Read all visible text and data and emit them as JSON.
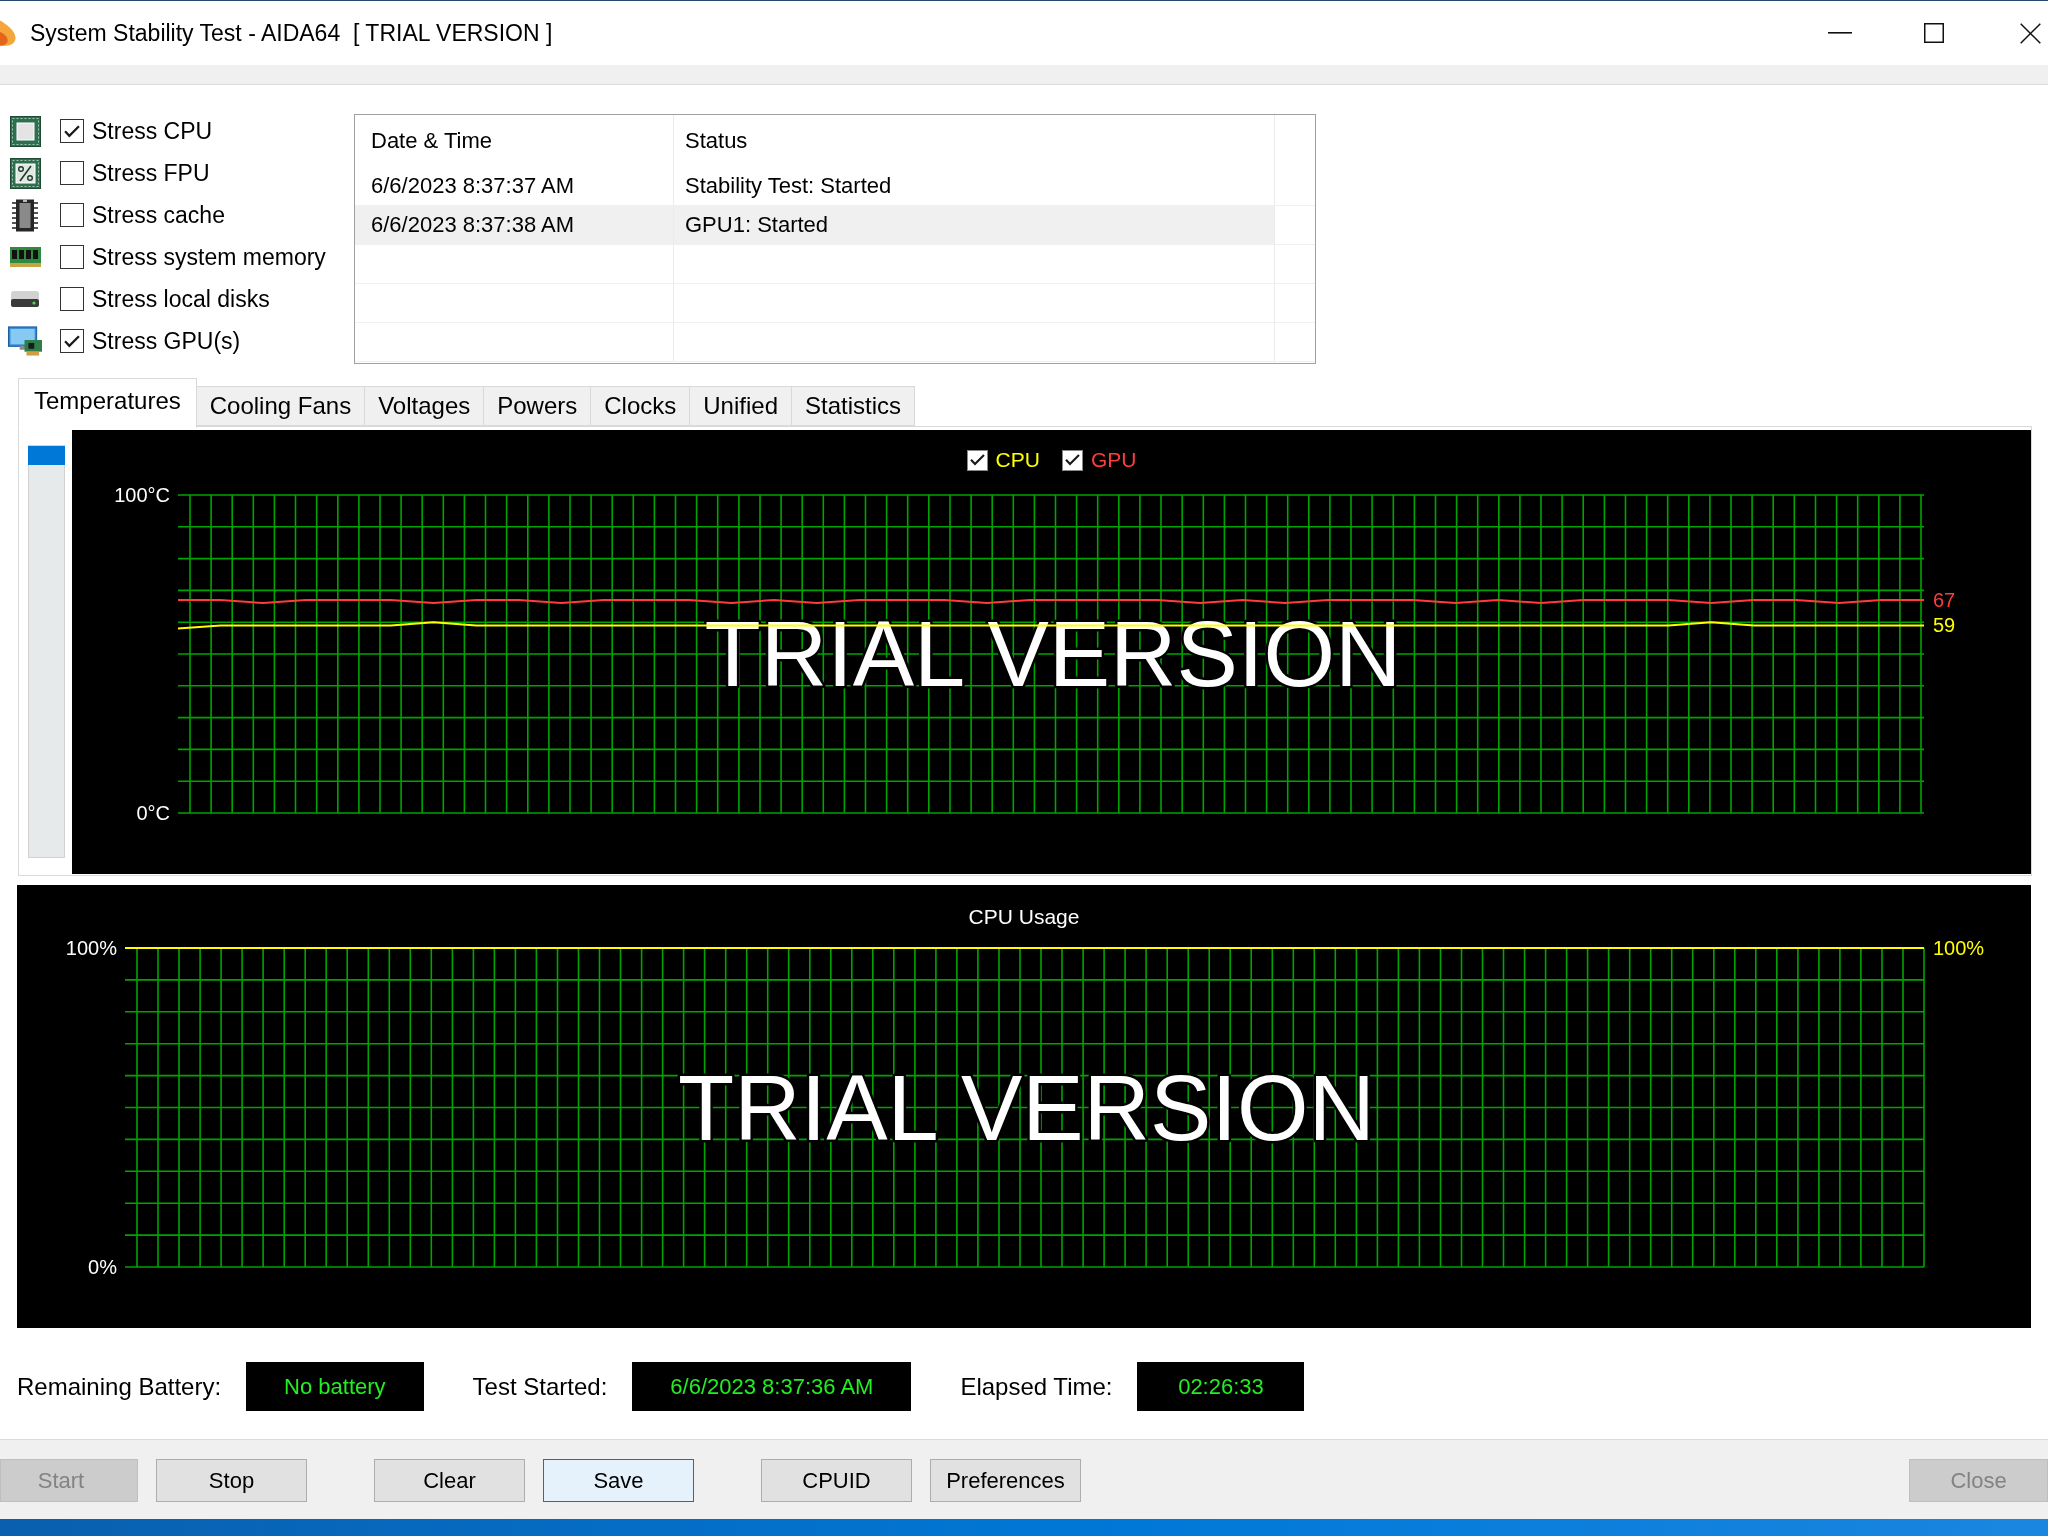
{
  "window": {
    "title": "System Stability Test - AIDA64  [ TRIAL VERSION ]"
  },
  "stress_options": [
    {
      "kind": "cpu",
      "label": "Stress CPU",
      "checked": true
    },
    {
      "kind": "fpu",
      "label": "Stress FPU",
      "checked": false
    },
    {
      "kind": "cache",
      "label": "Stress cache",
      "checked": false
    },
    {
      "kind": "memory",
      "label": "Stress system memory",
      "checked": false
    },
    {
      "kind": "disk",
      "label": "Stress local disks",
      "checked": false
    },
    {
      "kind": "gpu",
      "label": "Stress GPU(s)",
      "checked": true
    }
  ],
  "log": {
    "columns": [
      "Date & Time",
      "Status"
    ],
    "rows": [
      {
        "cells": [
          "6/6/2023 8:37:37 AM",
          "Stability Test: Started"
        ],
        "selected": false
      },
      {
        "cells": [
          "6/6/2023 8:37:38 AM",
          "GPU1: Started"
        ],
        "selected": true
      }
    ]
  },
  "tabs": [
    {
      "label": "Temperatures",
      "selected": true
    },
    {
      "label": "Cooling Fans",
      "selected": false
    },
    {
      "label": "Voltages",
      "selected": false
    },
    {
      "label": "Powers",
      "selected": false
    },
    {
      "label": "Clocks",
      "selected": false
    },
    {
      "label": "Unified",
      "selected": false
    },
    {
      "label": "Statistics",
      "selected": false
    }
  ],
  "scale_slider": {
    "level": 1
  },
  "temperature_chart": {
    "legend": [
      {
        "label": "CPU",
        "checked": true,
        "color": "#ffff00"
      },
      {
        "label": "GPU",
        "checked": true,
        "color": "#ff3c3c"
      }
    ],
    "readings": [
      "67",
      "59"
    ],
    "chart_data": {
      "type": "line",
      "tick_labels": "y",
      "grid": true,
      "ylim": [
        0,
        100
      ],
      "yticks": [
        {
          "value": 0,
          "label": "0°C"
        },
        {
          "value": 100,
          "label": "100°C"
        }
      ],
      "annotations": [
        "TRIAL VERSION"
      ],
      "series": [
        {
          "color": "#ff3c3c",
          "values": [
            67,
            67,
            66,
            67,
            67,
            67,
            66,
            67,
            67,
            66,
            67,
            67,
            67,
            66,
            67,
            66,
            67,
            67,
            67,
            66,
            67,
            67,
            67,
            67,
            66,
            67,
            66,
            67,
            67,
            67,
            66,
            67,
            66,
            67,
            67,
            67,
            66,
            67,
            67,
            66,
            67,
            67
          ]
        },
        {
          "color": "#ffff00",
          "values": [
            58,
            59,
            59,
            59,
            59,
            59,
            60,
            59,
            59,
            59,
            59,
            59,
            59,
            59,
            59,
            59,
            59,
            59,
            59,
            59,
            59,
            59,
            59,
            59,
            59,
            59,
            59,
            59,
            59,
            59,
            59,
            59,
            59,
            59,
            59,
            59,
            60,
            59,
            59,
            59,
            59,
            59
          ]
        }
      ]
    }
  },
  "usage_chart": {
    "readings": [
      "100%"
    ],
    "chart_data": {
      "type": "line",
      "title": "CPU Usage",
      "tick_labels": "y",
      "grid": true,
      "ylim": [
        0,
        100
      ],
      "yticks": [
        {
          "value": 0,
          "label": "0%"
        },
        {
          "value": 100,
          "label": "100%"
        }
      ],
      "annotations": [
        "TRIAL VERSION"
      ],
      "series": [
        {
          "color": "#ffff00",
          "values": [
            100,
            100,
            100,
            100,
            100,
            100,
            100,
            100,
            100,
            100,
            100,
            100,
            100,
            100,
            100,
            100,
            100,
            100,
            100,
            100
          ]
        }
      ]
    }
  },
  "status": [
    {
      "label": "Remaining Battery:",
      "value": "No battery"
    },
    {
      "label": "Test Started:",
      "value": "6/6/2023 8:37:36 AM"
    },
    {
      "label": "Elapsed Time:",
      "value": "02:26:33"
    }
  ],
  "button_groups": [
    [
      {
        "label": "Start",
        "disabled": true,
        "focused": false
      },
      {
        "label": "Stop",
        "disabled": false,
        "focused": false
      }
    ],
    [
      {
        "label": "Clear",
        "disabled": false,
        "focused": false
      },
      {
        "label": "Save",
        "disabled": false,
        "focused": true
      }
    ],
    [
      {
        "label": "CPUID",
        "disabled": false,
        "focused": false
      },
      {
        "label": "Preferences",
        "disabled": false,
        "focused": false
      }
    ],
    [
      {
        "label": "Close",
        "disabled": true,
        "focused": false
      }
    ]
  ]
}
